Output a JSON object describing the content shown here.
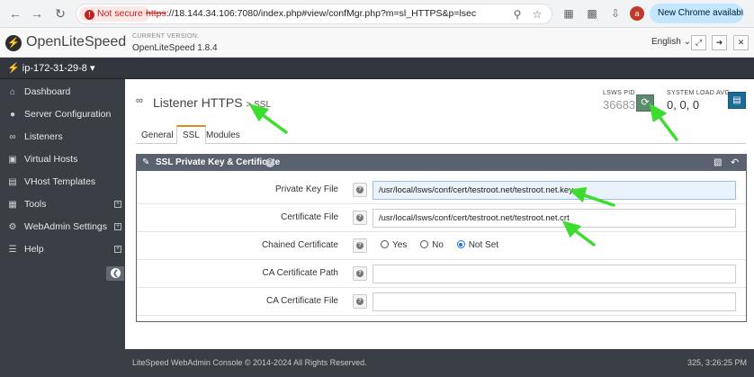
{
  "browser": {
    "secure_label": "Not secure",
    "url_scheme": "https",
    "url_rest": "://18.144.34.106:7080/index.php#view/confMgr.php?m=sl_HTTPS&p=lsec",
    "profile_initial": "a",
    "update_label": "New Chrome available"
  },
  "header": {
    "brand": "OpenLiteSpeed",
    "version_label": "CURRENT VERSION:",
    "version_value": "OpenLiteSpeed 1.8.4",
    "language": "English"
  },
  "server": {
    "name": "ip-172-31-29-8"
  },
  "sidebar": {
    "items": [
      {
        "label": "Dashboard",
        "icon": "dashboard-icon",
        "expandable": false
      },
      {
        "label": "Server Configuration",
        "icon": "globe-icon",
        "expandable": false
      },
      {
        "label": "Listeners",
        "icon": "link-icon",
        "expandable": false
      },
      {
        "label": "Virtual Hosts",
        "icon": "cubes-icon",
        "expandable": false
      },
      {
        "label": "VHost Templates",
        "icon": "file-icon",
        "expandable": false
      },
      {
        "label": "Tools",
        "icon": "grid-icon",
        "expandable": true
      },
      {
        "label": "WebAdmin Settings",
        "icon": "gear-icon",
        "expandable": true
      },
      {
        "label": "Help",
        "icon": "list-icon",
        "expandable": true
      }
    ]
  },
  "page": {
    "title": "Listener HTTPS",
    "subtitle": "> SSL",
    "pid_label": "LSWS PID",
    "pid_value": "36683",
    "load_label": "SYSTEM LOAD AVG",
    "load_value": "0, 0, 0"
  },
  "tabs": [
    {
      "label": "General",
      "active": false
    },
    {
      "label": "SSL",
      "active": true
    },
    {
      "label": "Modules",
      "active": false
    }
  ],
  "panel": {
    "title": "SSL Private Key & Certificate",
    "rows": [
      {
        "label": "Private Key File",
        "value": "/usr/local/lsws/conf/cert/testroot.net/testroot.net.key"
      },
      {
        "label": "Certificate File",
        "value": "/usr/local/lsws/conf/cert/testroot.net/testroot.net.crt"
      },
      {
        "label": "Chained Certificate",
        "options": [
          "Yes",
          "No",
          "Not Set"
        ],
        "selected": "Not Set"
      },
      {
        "label": "CA Certificate Path",
        "value": ""
      },
      {
        "label": "CA Certificate File",
        "value": ""
      }
    ]
  },
  "footer": {
    "copyright": "LiteSpeed WebAdmin Console © 2014-2024 All Rights Reserved.",
    "time": "325, 3:26:25 PM"
  },
  "colors": {
    "accent_tab": "#e08a1e",
    "restart": "#5d8a6e",
    "chart": "#1d6a96",
    "annotation": "#3ddc2e"
  }
}
